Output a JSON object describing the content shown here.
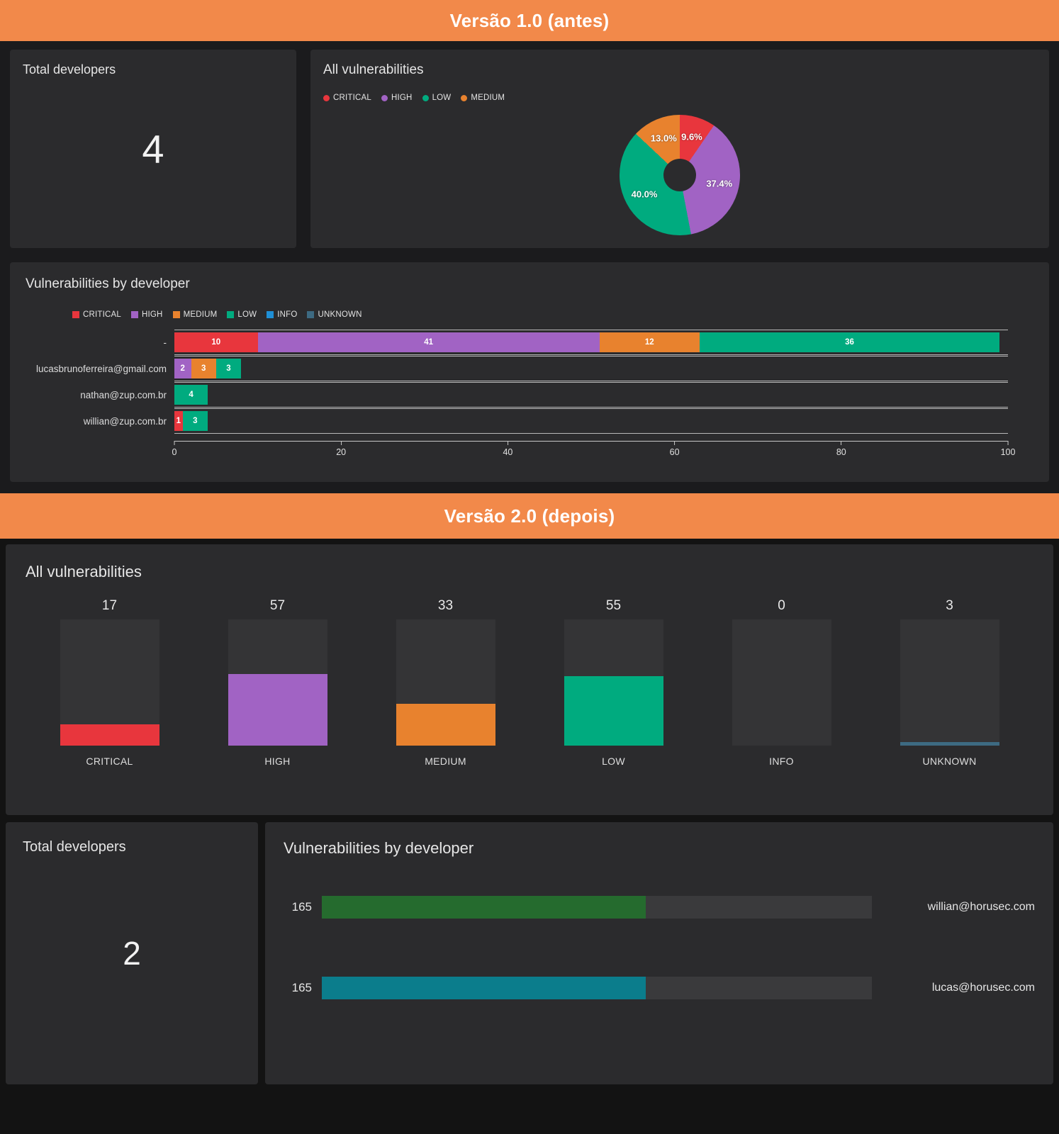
{
  "banners": {
    "v1": "Versão 1.0 (antes)",
    "v2": "Versão 2.0 (depois)"
  },
  "colors": {
    "banner_orange": "#f2894a",
    "critical": "#e8363d",
    "high": "#a163c4",
    "medium": "#e8822e",
    "low": "#00ab7f",
    "info": "#1f8fd6",
    "unknown": "#3d6a82",
    "dev_green": "#256b2e",
    "dev_teal": "#0b7d8c",
    "card_bg": "#2b2b2d",
    "track_bg": "#343436"
  },
  "v1": {
    "total_developers": {
      "title": "Total developers",
      "value": "4"
    },
    "all_vulnerabilities": {
      "title": "All vulnerabilities",
      "legend": [
        {
          "label": "CRITICAL",
          "color": "#e8363d"
        },
        {
          "label": "HIGH",
          "color": "#a163c4"
        },
        {
          "label": "LOW",
          "color": "#00ab7f"
        },
        {
          "label": "MEDIUM",
          "color": "#e8822e"
        }
      ]
    },
    "by_developer": {
      "title": "Vulnerabilities by developer",
      "legend": [
        {
          "label": "CRITICAL",
          "color": "#e8363d"
        },
        {
          "label": "HIGH",
          "color": "#a163c4"
        },
        {
          "label": "MEDIUM",
          "color": "#e8822e"
        },
        {
          "label": "LOW",
          "color": "#00ab7f"
        },
        {
          "label": "INFO",
          "color": "#1f8fd6"
        },
        {
          "label": "UNKNOWN",
          "color": "#3d6a82"
        }
      ],
      "axis_ticks": [
        "0",
        "20",
        "40",
        "60",
        "80",
        "100"
      ]
    }
  },
  "v2": {
    "all_vulnerabilities": {
      "title": "All vulnerabilities"
    },
    "total_developers": {
      "title": "Total developers",
      "value": "2"
    },
    "by_developer": {
      "title": "Vulnerabilities by developer"
    }
  },
  "chart_data": [
    {
      "type": "pie",
      "id": "v1-all-vulnerabilities-donut",
      "title": "All vulnerabilities",
      "legend_position": "top-left",
      "categories": [
        "CRITICAL",
        "HIGH",
        "LOW",
        "MEDIUM"
      ],
      "values": [
        9.6,
        37.4,
        40.0,
        13.0
      ],
      "labels": [
        "9.6%",
        "37.4%",
        "40.0%",
        "13.0%"
      ],
      "colors": [
        "#e8363d",
        "#a163c4",
        "#00ab7f",
        "#e8822e"
      ],
      "unit": "%"
    },
    {
      "type": "bar",
      "id": "v1-vulnerabilities-by-developer",
      "title": "Vulnerabilities by developer",
      "orientation": "horizontal",
      "stacked": true,
      "xlabel": "",
      "ylabel": "",
      "xlim": [
        0,
        100
      ],
      "xticks": [
        0,
        20,
        40,
        60,
        80,
        100
      ],
      "grid": false,
      "legend_position": "top",
      "categories": [
        "-",
        "lucasbrunoferreira@gmail.com",
        "nathan@zup.com.br",
        "willian@zup.com.br"
      ],
      "series": [
        {
          "name": "CRITICAL",
          "color": "#e8363d",
          "values": [
            10,
            0,
            0,
            1
          ]
        },
        {
          "name": "HIGH",
          "color": "#a163c4",
          "values": [
            41,
            2,
            0,
            0
          ]
        },
        {
          "name": "MEDIUM",
          "color": "#e8822e",
          "values": [
            12,
            3,
            0,
            0
          ]
        },
        {
          "name": "LOW",
          "color": "#00ab7f",
          "values": [
            36,
            3,
            4,
            3
          ]
        },
        {
          "name": "INFO",
          "color": "#1f8fd6",
          "values": [
            0,
            0,
            0,
            0
          ]
        },
        {
          "name": "UNKNOWN",
          "color": "#3d6a82",
          "values": [
            0,
            0,
            0,
            0
          ]
        }
      ],
      "rows": [
        {
          "label": "-",
          "segments": [
            {
              "name": "CRITICAL",
              "value": 10,
              "text": "10",
              "color": "#e8363d"
            },
            {
              "name": "HIGH",
              "value": 41,
              "text": "41",
              "color": "#a163c4"
            },
            {
              "name": "MEDIUM",
              "value": 12,
              "text": "12",
              "color": "#e8822e"
            },
            {
              "name": "LOW",
              "value": 36,
              "text": "36",
              "color": "#00ab7f"
            }
          ]
        },
        {
          "label": "lucasbrunoferreira@gmail.com",
          "segments": [
            {
              "name": "HIGH",
              "value": 2,
              "text": "2",
              "color": "#a163c4"
            },
            {
              "name": "MEDIUM",
              "value": 3,
              "text": "3",
              "color": "#e8822e"
            },
            {
              "name": "LOW",
              "value": 3,
              "text": "3",
              "color": "#00ab7f"
            }
          ]
        },
        {
          "label": "nathan@zup.com.br",
          "segments": [
            {
              "name": "LOW",
              "value": 4,
              "text": "4",
              "color": "#00ab7f"
            }
          ]
        },
        {
          "label": "willian@zup.com.br",
          "segments": [
            {
              "name": "CRITICAL",
              "value": 1,
              "text": "1",
              "color": "#e8363d"
            },
            {
              "name": "LOW",
              "value": 3,
              "text": "3",
              "color": "#00ab7f"
            }
          ]
        }
      ]
    },
    {
      "type": "bar",
      "id": "v2-all-vulnerabilities",
      "title": "All vulnerabilities",
      "orientation": "vertical",
      "grid": false,
      "legend_position": "none",
      "xlabel": "",
      "ylabel": "",
      "ylim": [
        0,
        100
      ],
      "categories": [
        "CRITICAL",
        "HIGH",
        "MEDIUM",
        "LOW",
        "INFO",
        "UNKNOWN"
      ],
      "values": [
        17,
        57,
        33,
        55,
        0,
        3
      ],
      "colors": [
        "#e8363d",
        "#a163c4",
        "#e8822e",
        "#00ab7f",
        "#1f8fd6",
        "#3d6a82"
      ]
    },
    {
      "type": "bar",
      "id": "v2-vulnerabilities-by-developer",
      "title": "Vulnerabilities by developer",
      "orientation": "horizontal",
      "grid": false,
      "legend_position": "none",
      "xlim": [
        0,
        280
      ],
      "categories": [
        "willian@horusec.com",
        "lucas@horusec.com"
      ],
      "values": [
        165,
        165
      ],
      "value_labels": [
        "165",
        "165"
      ],
      "colors": [
        "#256b2e",
        "#0b7d8c"
      ]
    }
  ]
}
